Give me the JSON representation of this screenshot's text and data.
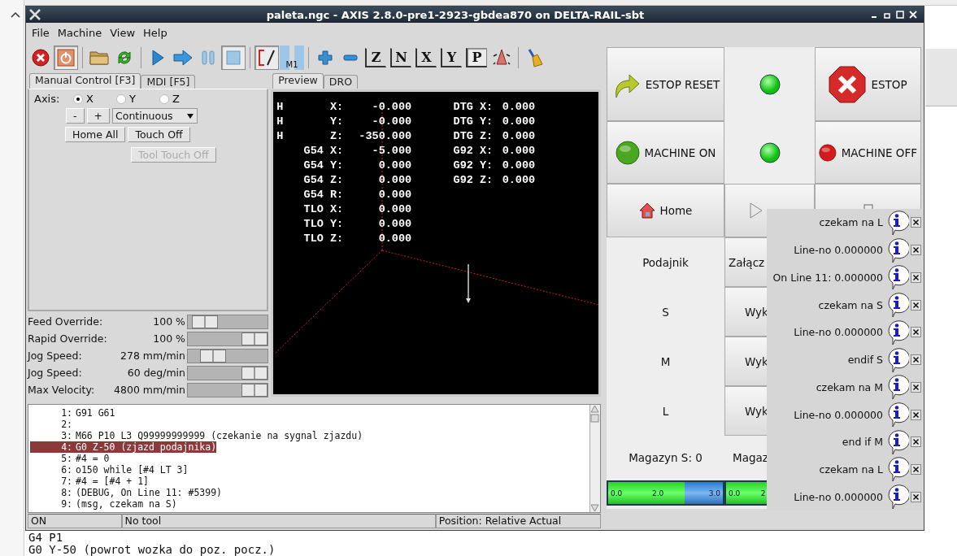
{
  "window": {
    "title": "paleta.ngc - AXIS 2.8.0-pre1-2923-gbdea870 on DELTA-RAIL-sbt"
  },
  "menu": [
    "File",
    "Machine",
    "View",
    "Help"
  ],
  "toolbar": [
    {
      "kind": "estop",
      "pressed": false
    },
    {
      "kind": "power",
      "pressed": true
    },
    {
      "kind": "separator"
    },
    {
      "kind": "open",
      "pressed": false
    },
    {
      "kind": "reload",
      "pressed": false
    },
    {
      "kind": "separator"
    },
    {
      "kind": "run",
      "pressed": false
    },
    {
      "kind": "step",
      "pressed": false
    },
    {
      "kind": "pause",
      "pressed": false
    },
    {
      "kind": "stop",
      "pressed": true
    },
    {
      "kind": "separator"
    },
    {
      "kind": "blockdelete",
      "pressed": true
    },
    {
      "kind": "optstop",
      "pressed": false,
      "glyph": "M1"
    },
    {
      "kind": "separator"
    },
    {
      "kind": "zoomin",
      "pressed": false
    },
    {
      "kind": "zoomout",
      "pressed": false
    },
    {
      "kind": "view",
      "pressed": false,
      "glyph": "Z"
    },
    {
      "kind": "view",
      "pressed": false,
      "glyph": "N"
    },
    {
      "kind": "view",
      "pressed": false,
      "glyph": "X"
    },
    {
      "kind": "view",
      "pressed": false,
      "glyph": "Y"
    },
    {
      "kind": "view",
      "pressed": true,
      "glyph": "P"
    },
    {
      "kind": "rotate",
      "pressed": false
    },
    {
      "kind": "separator"
    },
    {
      "kind": "clear",
      "pressed": false
    }
  ],
  "left_tabs": [
    {
      "label": "Manual Control [F3]",
      "selected": true
    },
    {
      "label": "MDI [F5]",
      "selected": false
    }
  ],
  "manual": {
    "axis_label": "Axis:",
    "axes": [
      {
        "label": "X",
        "selected": true
      },
      {
        "label": "Y",
        "selected": false
      },
      {
        "label": "Z",
        "selected": false
      }
    ],
    "minus": "-",
    "plus": "+",
    "increment": "Continuous",
    "buttons": [
      {
        "label": "Home All",
        "disabled": false
      },
      {
        "label": "Touch Off",
        "disabled": false
      },
      {
        "label": "Tool Touch Off",
        "disabled": true
      }
    ]
  },
  "sliders": [
    {
      "label": "Feed Override:",
      "reading": "100 %",
      "level": 0.08
    },
    {
      "label": "Rapid Override:",
      "reading": "100 %",
      "level": 1
    },
    {
      "label": "Jog Speed:",
      "reading": "278 mm/min",
      "level": 0.22
    },
    {
      "label": "Jog Speed:",
      "reading": "60 deg/min",
      "level": 1
    },
    {
      "label": "Max Velocity:",
      "reading": "4800 mm/min",
      "level": 1
    }
  ],
  "preview_tabs": [
    {
      "label": "Preview",
      "selected": true
    },
    {
      "label": "DRO",
      "selected": false
    }
  ],
  "dro": [
    {
      "flag": "H",
      "label": "X:",
      "value": "-0.000",
      "label2": "DTG X:",
      "value2": "0.000"
    },
    {
      "flag": "H",
      "label": "Y:",
      "value": "-0.000",
      "label2": "DTG Y:",
      "value2": "0.000"
    },
    {
      "flag": "H",
      "label": "Z:",
      "value": "-350.000",
      "label2": "DTG Z:",
      "value2": "0.000"
    },
    {
      "label": "G54 X:",
      "value": "-5.000",
      "label2": "G92 X:",
      "value2": "0.000"
    },
    {
      "label": "G54 Y:",
      "value": "0.000",
      "label2": "G92 Y:",
      "value2": "0.000"
    },
    {
      "label": "G54 Z:",
      "value": "0.000",
      "label2": "G92 Z:",
      "value2": "0.000"
    },
    {
      "label": "G54 R:",
      "value": "0.000"
    },
    {
      "label": "TLO X:",
      "value": "0.000"
    },
    {
      "label": "TLO Y:",
      "value": "0.000"
    },
    {
      "label": "TLO Z:",
      "value": "0.000"
    }
  ],
  "program": {
    "lines": [
      {
        "number": "1:",
        "code": "G91 G61",
        "selected": false
      },
      {
        "number": "2:",
        "selected": false
      },
      {
        "number": "3:",
        "code": "M66 P10 L3 Q99999999999 (czekanie na sygnal zjazdu)",
        "selected": false
      },
      {
        "number": "4:",
        "code": "G0 Z-50 (zjazd podajnika)",
        "selected": true
      },
      {
        "number": "5:",
        "code": "#4 = 0",
        "selected": false
      },
      {
        "number": "6:",
        "code": "o150 while [#4 LT 3]",
        "selected": false
      },
      {
        "number": "7:",
        "code": "#4 = [#4 + 1]",
        "selected": false
      },
      {
        "number": "8:",
        "code": "(DEBUG, On Line 11: #5399)",
        "selected": false
      },
      {
        "number": "9:",
        "code": "(msg, czekam na S)",
        "selected": false
      }
    ]
  },
  "status_bar": [
    "ON",
    "No tool",
    "Position: Relative Actual"
  ],
  "panel": {
    "estop_reset": "ESTOP RESET",
    "estop": "ESTOP",
    "machine_on": "MACHINE ON",
    "machine_off": "MACHINE OFF",
    "leds": [
      {
        "on": true
      },
      {
        "on": true
      }
    ],
    "home": "Home",
    "feeder_label": "Podajnik",
    "feeder_button": "Załącz",
    "rows": [
      {
        "label": "S",
        "button": "Wyk"
      },
      {
        "label": "M",
        "button": "Wyk"
      },
      {
        "label": "L",
        "button": "Wyk"
      }
    ],
    "magazines": [
      "Magazyn S: 0",
      "Magaz"
    ],
    "bars": [
      {
        "labels": [
          "0.0",
          "2.0",
          "3.0"
        ],
        "level": 0.67
      },
      {
        "labels": [
          "0.0",
          "2"
        ]
      }
    ]
  },
  "notifications": [
    {
      "text": "czekam na L"
    },
    {
      "text": "Line-no 0.000000"
    },
    {
      "text": "On Line 11: 0.000000"
    },
    {
      "text": "czekam na S"
    },
    {
      "text": "Line-no 0.000000"
    },
    {
      "text": "endif S"
    },
    {
      "text": "czekam na M"
    },
    {
      "text": "Line-no 0.000000"
    },
    {
      "text": "end if M"
    },
    {
      "text": "czekam na L"
    },
    {
      "text": "Line-no 0.000000"
    }
  ],
  "background": {
    "lines": [
      "G4 P1",
      "G0 Y-50 (powrot wozka do poz. pocz.)"
    ]
  }
}
